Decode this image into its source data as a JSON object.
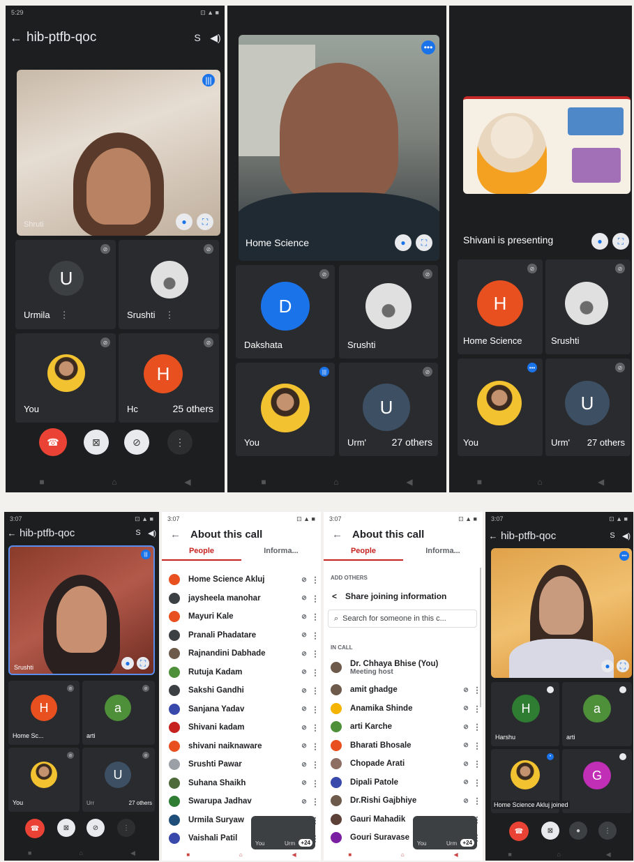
{
  "meeting": {
    "code": "hib-ptfb-qoc",
    "code_chevron": "›"
  },
  "status_bar": {
    "time_1": "5:29",
    "time_2": "3:07",
    "right": "⊡ ▲ ■"
  },
  "panel_1": {
    "main_video_name": "Shruti",
    "tiles": [
      {
        "initial": "U",
        "name": "Urmila",
        "avatar_color": "#3c4043"
      },
      {
        "initial": "",
        "name": "Srushti",
        "avatar_color": "#9aa0a6"
      },
      {
        "initial": "",
        "name": "You",
        "avatar_color": "#b0bec5"
      },
      {
        "initial": "H",
        "name": "Hc",
        "avatar_color": "#e8501f"
      }
    ],
    "others": "25 others"
  },
  "panel_2": {
    "main_video_name": "Home Science",
    "tiles": [
      {
        "initial": "D",
        "name": "Dakshata",
        "avatar_color": "#1a73e8"
      },
      {
        "initial": "",
        "name": "Srushti",
        "avatar_color": "#9aa0a6"
      },
      {
        "initial": "",
        "name": "You",
        "avatar_color": "#b0bec5"
      },
      {
        "initial": "U",
        "name": "Urm'",
        "avatar_color": "#3c4f63"
      }
    ],
    "others": "27 others"
  },
  "panel_3": {
    "presenting_label": "Shivani is presenting",
    "tiles": [
      {
        "initial": "H",
        "name": "Home Science",
        "avatar_color": "#e8501f"
      },
      {
        "initial": "",
        "name": "Srushti",
        "avatar_color": "#9aa0a6"
      },
      {
        "initial": "",
        "name": "You",
        "avatar_color": "#b0bec5"
      },
      {
        "initial": "U",
        "name": "Urm'",
        "avatar_color": "#3c4f63"
      }
    ],
    "others": "27 others"
  },
  "panel_4": {
    "main_video_name": "Srushti",
    "tiles": [
      {
        "initial": "H",
        "name": "Home Sc...",
        "avatar_color": "#e8501f"
      },
      {
        "initial": "a",
        "name": "arti",
        "avatar_color": "#4e8f3a"
      },
      {
        "initial": "",
        "name": "You",
        "avatar_color": "#b0bec5"
      },
      {
        "initial": "U",
        "name": "Urr",
        "avatar_color": "#3c4f63"
      }
    ],
    "others": "27 others"
  },
  "about_panel_a": {
    "title": "About this call",
    "tab_people": "People",
    "tab_info": "Informa...",
    "people": [
      {
        "name": "Home Science Akluj",
        "color": "#e8501f"
      },
      {
        "name": "jaysheela manohar",
        "color": "#3c4043"
      },
      {
        "name": "Mayuri Kale",
        "color": "#e8501f"
      },
      {
        "name": "Pranali Phadatare",
        "color": "#3c4043"
      },
      {
        "name": "Rajnandini Dabhade",
        "color": "#6d5a4a"
      },
      {
        "name": "Rutuja Kadam",
        "color": "#4e8f3a"
      },
      {
        "name": "Sakshi Gandhi",
        "color": "#3c4043"
      },
      {
        "name": "Sanjana Yadav",
        "color": "#3949ab"
      },
      {
        "name": "Shivani kadam",
        "color": "#c5221f"
      },
      {
        "name": "shivani naiknaware",
        "color": "#e8501f"
      },
      {
        "name": "Srushti Pawar",
        "color": "#9aa0a6"
      },
      {
        "name": "Suhana Shaikh",
        "color": "#4e6a3a"
      },
      {
        "name": "Swarupa Jadhav",
        "color": "#2e7d32"
      },
      {
        "name": "Urmila Suryaw",
        "color": "#1f4e79"
      },
      {
        "name": "Vaishali Patil",
        "color": "#3949ab"
      }
    ],
    "mini_label_you": "You",
    "mini_label_other": "Urm",
    "mini_count": "+24"
  },
  "about_panel_b": {
    "title": "About this call",
    "tab_people": "People",
    "tab_info": "Informa...",
    "add_others": "ADD OTHERS",
    "share": "Share joining information",
    "search_placeholder": "Search for someone in this c...",
    "in_call": "IN CALL",
    "host_name": "Dr. Chhaya Bhise (You)",
    "host_role": "Meeting host",
    "people": [
      {
        "name": "amit ghadge",
        "color": "#6d5a4a"
      },
      {
        "name": "Anamika Shinde",
        "color": "#f4b400"
      },
      {
        "name": "arti Karche",
        "color": "#4e8f3a"
      },
      {
        "name": "Bharati Bhosale",
        "color": "#e8501f"
      },
      {
        "name": "Chopade Arati",
        "color": "#8d6e63"
      },
      {
        "name": "Dipali Patole",
        "color": "#3949ab"
      },
      {
        "name": "Dr.Rishi Gajbhiye",
        "color": "#6d5a4a"
      },
      {
        "name": "Gauri Mahadik",
        "color": "#5d4037"
      },
      {
        "name": "Gouri Suravase",
        "color": "#7b1fa2"
      }
    ],
    "mini_label_you": "You",
    "mini_label_other": "Urm",
    "mini_count": "+24"
  },
  "panel_5": {
    "tiles": [
      {
        "initial": "H",
        "name": "Harshu",
        "avatar_color": "#2e7d32"
      },
      {
        "initial": "a",
        "name": "arti",
        "avatar_color": "#4e8f3a"
      },
      {
        "initial": "",
        "name": "",
        "avatar_color": "#b0bec5"
      },
      {
        "initial": "G",
        "name": "",
        "avatar_color": "#c02fb5"
      }
    ],
    "joined_toast": "Home Science Akluj joined"
  },
  "icons": {
    "back": "←",
    "switch_camera": "S",
    "speaker": "◀)",
    "mic_off": "⊘",
    "expand": "⛶",
    "more": "⋮",
    "end_call": "☎",
    "share": "<",
    "search": "⌕"
  },
  "colors": {
    "end_call_red": "#ea4335",
    "accent_blue": "#1a73e8",
    "people_tab_red": "#c5221f"
  }
}
